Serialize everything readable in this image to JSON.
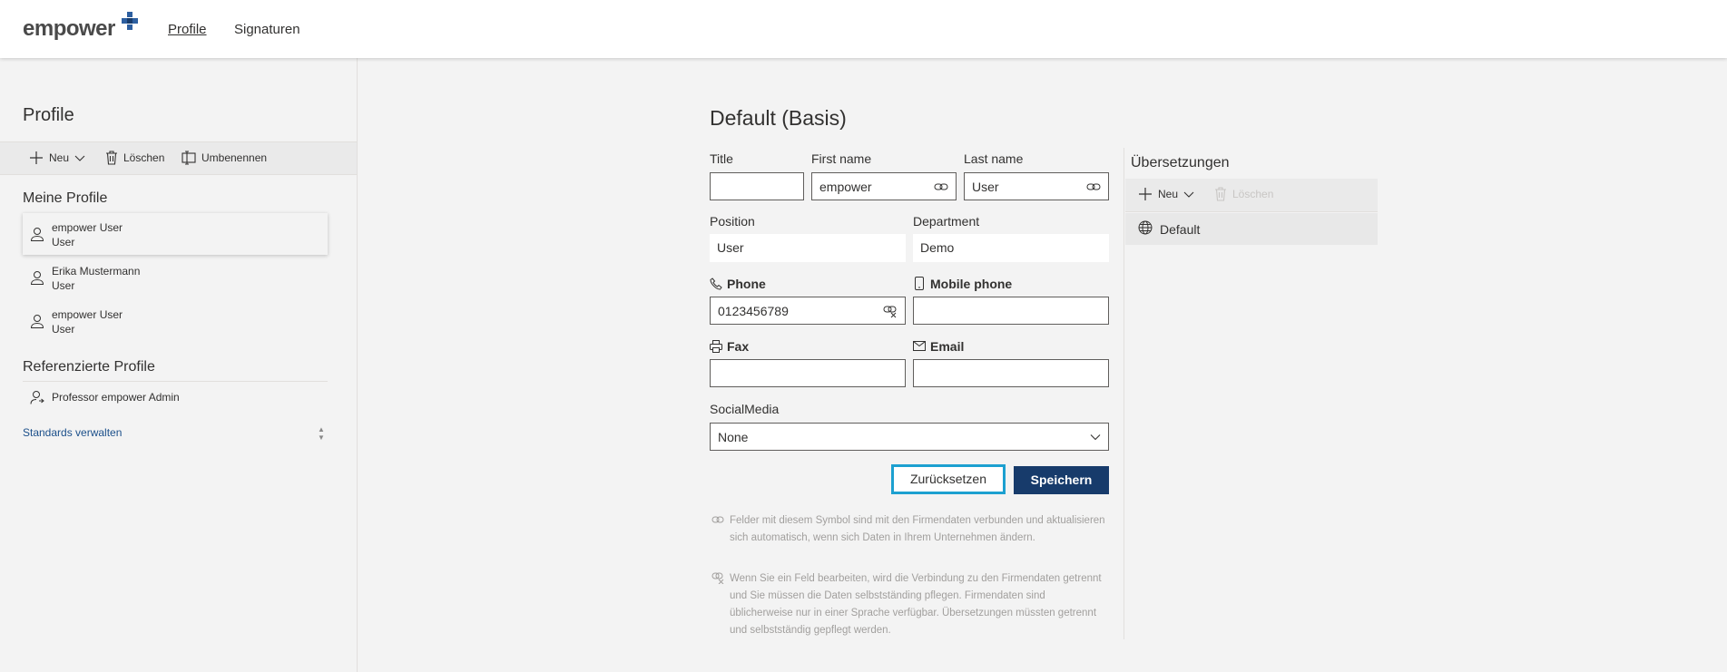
{
  "header": {
    "logo_text": "empower",
    "nav": [
      {
        "label": "Profile",
        "active": true
      },
      {
        "label": "Signaturen",
        "active": false
      }
    ]
  },
  "sidebar": {
    "title": "Profile",
    "toolbar": {
      "new": "Neu",
      "delete": "Löschen",
      "rename": "Umbenennen"
    },
    "my_profiles_heading": "Meine Profile",
    "my_profiles": [
      {
        "name": "empower User",
        "role": "User",
        "selected": true
      },
      {
        "name": "Erika Mustermann",
        "role": "User",
        "selected": false
      },
      {
        "name": "empower User",
        "role": "User",
        "selected": false
      }
    ],
    "referenced_heading": "Referenzierte Profile",
    "referenced_profiles": [
      {
        "name": "Professor empower Admin"
      }
    ],
    "manage_standards": "Standards verwalten"
  },
  "form": {
    "title": "Default (Basis)",
    "fields": {
      "title": {
        "label": "Title",
        "value": ""
      },
      "first_name": {
        "label": "First name",
        "value": "empower"
      },
      "last_name": {
        "label": "Last name",
        "value": "User"
      },
      "position": {
        "label": "Position",
        "value": "User"
      },
      "department": {
        "label": "Department",
        "value": "Demo"
      },
      "phone": {
        "label": "Phone",
        "value": "0123456789"
      },
      "mobile_phone": {
        "label": "Mobile phone",
        "value": ""
      },
      "fax": {
        "label": "Fax",
        "value": ""
      },
      "email": {
        "label": "Email",
        "value": ""
      },
      "social_media": {
        "label": "SocialMedia",
        "value": "None"
      }
    },
    "reset_label": "Zurücksetzen",
    "save_label": "Speichern",
    "info_linked": "Felder mit diesem Symbol sind mit den Firmendaten verbunden und aktualisieren sich automatisch, wenn sich Daten in Ihrem Unternehmen ändern.",
    "info_unlinked": "Wenn Sie ein Feld bearbeiten, wird die Verbindung zu den Firmendaten getrennt und Sie müssen die Daten selbstständing pflegen. Firmendaten sind üblicherweise nur in einer Sprache verfügbar. Übersetzungen müssten getrennt und selbstständig gepflegt werden."
  },
  "translations": {
    "title": "Übersetzungen",
    "toolbar": {
      "new": "Neu",
      "delete": "Löschen"
    },
    "items": [
      {
        "label": "Default"
      }
    ]
  },
  "colors": {
    "primary": "#173b6b",
    "focus_border": "#1ca0d0",
    "link": "#1b4f8a",
    "page_bg": "#f3f3f3"
  }
}
